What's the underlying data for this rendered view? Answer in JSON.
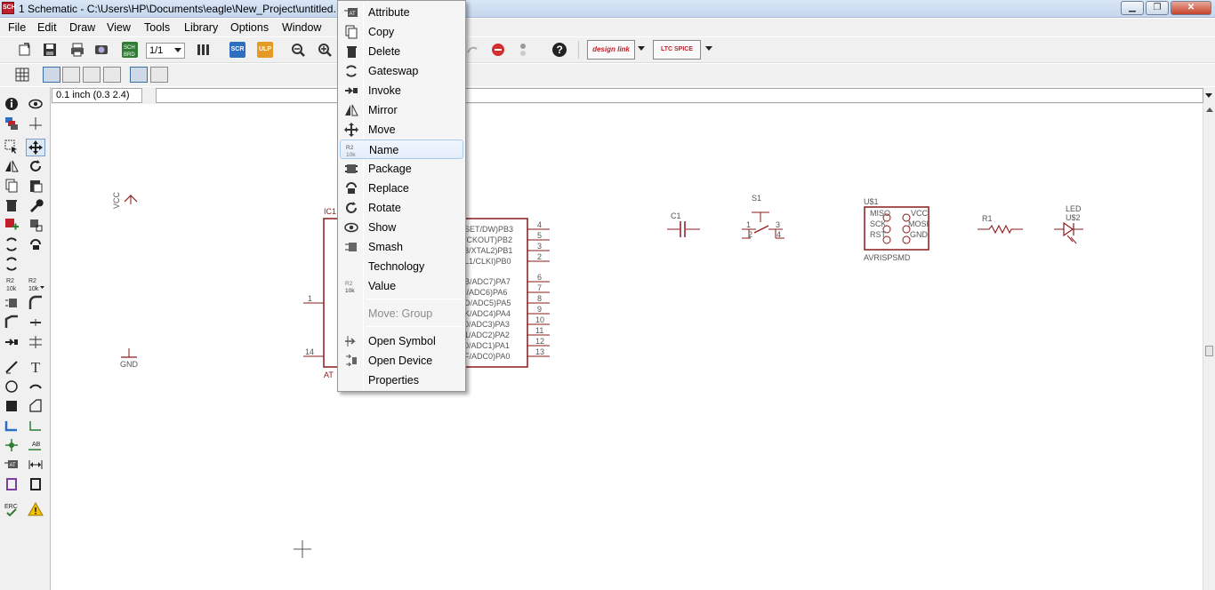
{
  "window": {
    "title": "1 Schematic - C:\\Users\\HP\\Documents\\eagle\\New_Project\\untitled.",
    "icon_label": "SCH"
  },
  "menu": [
    "File",
    "Edit",
    "Draw",
    "View",
    "Tools",
    "Library",
    "Options",
    "Window"
  ],
  "toolbar": {
    "sheet_combo": "1/1",
    "scr_label": "SCR",
    "ulp_label": "ULP",
    "designlink_label": "design link",
    "ltspice_label": "LTC SPICE"
  },
  "coord": {
    "value": "0.1 inch (0.3 2.4)"
  },
  "context_menu": {
    "items": [
      {
        "label": "Attribute",
        "icon": "attribute-icon"
      },
      {
        "label": "Copy",
        "icon": "copy-icon"
      },
      {
        "label": "Delete",
        "icon": "trash-icon"
      },
      {
        "label": "Gateswap",
        "icon": "gateswap-icon"
      },
      {
        "label": "Invoke",
        "icon": "invoke-icon"
      },
      {
        "label": "Mirror",
        "icon": "mirror-icon"
      },
      {
        "label": "Move",
        "icon": "move-icon"
      },
      {
        "label": "Name",
        "icon": "name-icon",
        "highlighted": true
      },
      {
        "label": "Package",
        "icon": "package-icon"
      },
      {
        "label": "Replace",
        "icon": "replace-icon"
      },
      {
        "label": "Rotate",
        "icon": "rotate-icon"
      },
      {
        "label": "Show",
        "icon": "eye-icon"
      },
      {
        "label": "Smash",
        "icon": "smash-icon"
      },
      {
        "label": "Technology",
        "icon": "technology-icon"
      },
      {
        "label": "Value",
        "icon": "value-icon"
      }
    ],
    "group_item": "Move: Group",
    "bottom_items": [
      "Open Symbol",
      "Open Device",
      "Properties"
    ]
  },
  "schematic": {
    "vcc_label": "VCC",
    "gnd_label": "GND",
    "ic_name_partial": "IC1",
    "ic_value_partial": "AT",
    "ic_right_pins": [
      {
        "label": "SET/DW)PB3",
        "num": "4"
      },
      {
        "label": "/CKOUT)PB2",
        "num": "5"
      },
      {
        "label": "3/XTAL2)PB1",
        "num": "3"
      },
      {
        "label": "L1/CLKI)PB0",
        "num": "2"
      },
      {
        "label": "B/ADC7)PA7",
        "num": "6"
      },
      {
        "label": "I/ADC6)PA6",
        "num": "7"
      },
      {
        "label": "D/ADC5)PA5",
        "num": "8"
      },
      {
        "label": "K/ADC4)PA4",
        "num": "9"
      },
      {
        "label": "0/ADC3)PA3",
        "num": "10"
      },
      {
        "label": "1/ADC2)PA2",
        "num": "11"
      },
      {
        "label": "0/ADC1)PA1",
        "num": "12"
      },
      {
        "label": "F/ADC0)PA0",
        "num": "13"
      }
    ],
    "ic_left_pins": [
      {
        "num": "1"
      },
      {
        "num": "14"
      }
    ],
    "c1_label": "C1",
    "s1_label": "S1",
    "s1_pins": [
      "1",
      "2",
      "3",
      "4"
    ],
    "u1_label": "U$1",
    "u1_value": "AVRISPSMD",
    "u1_pins_left": [
      "MISO",
      "SCK",
      "RST"
    ],
    "u1_pins_right": [
      "VCC",
      "MOSI",
      "GND"
    ],
    "r1_label": "R1",
    "led_label": "LED",
    "u2_label": "U$2"
  },
  "colors": {
    "schematic_red": "#8b1a1a",
    "menu_highlight": "#a8cbf1"
  }
}
